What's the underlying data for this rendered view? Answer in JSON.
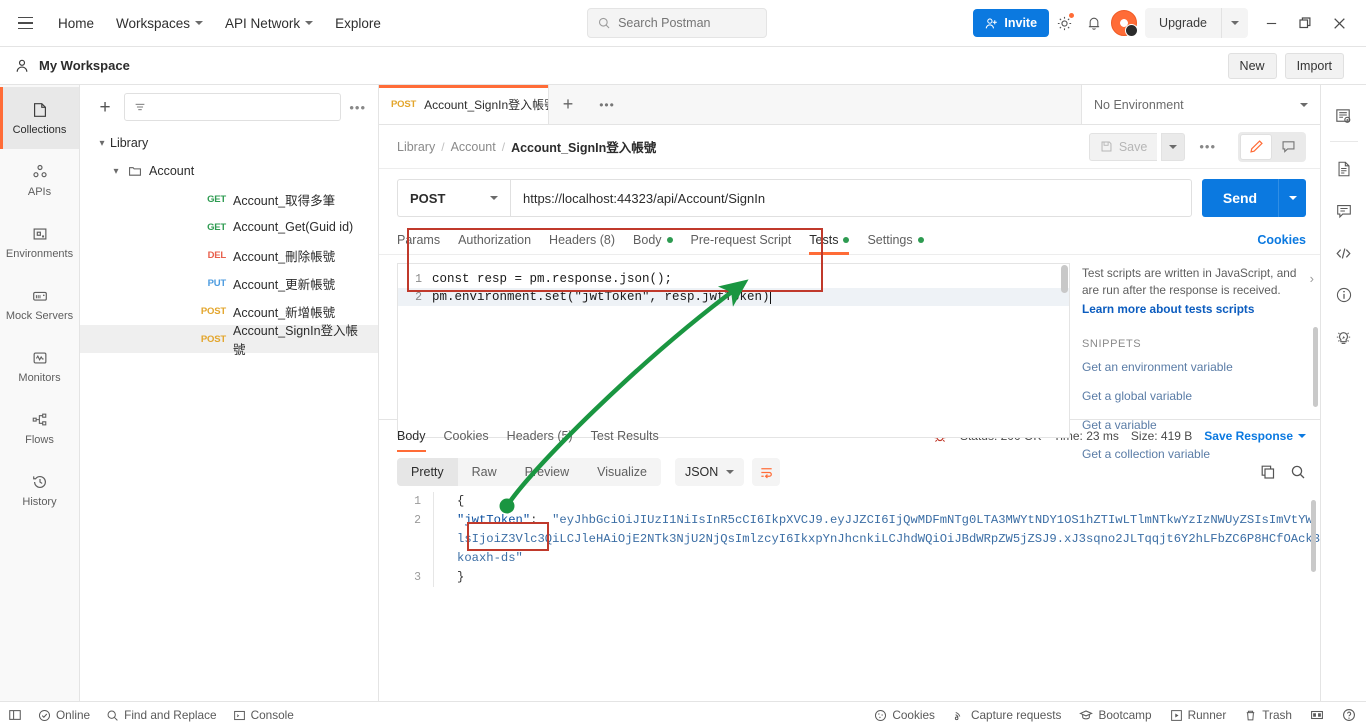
{
  "topbar": {
    "menu_icon": "hamburger-icon",
    "nav": [
      {
        "label": "Home",
        "has_caret": false
      },
      {
        "label": "Workspaces",
        "has_caret": true
      },
      {
        "label": "API Network",
        "has_caret": true
      },
      {
        "label": "Explore",
        "has_caret": false
      }
    ],
    "search_placeholder": "Search Postman",
    "invite_label": "Invite",
    "upgrade_label": "Upgrade",
    "settings_icon": "gear-icon",
    "notifications_icon": "bell-icon",
    "avatar_icon": "user-avatar",
    "minimize_icon": "minimize-icon",
    "maximize_icon": "maximize-icon",
    "close_icon": "close-icon"
  },
  "workspace_bar": {
    "name": "My Workspace",
    "new_label": "New",
    "import_label": "Import"
  },
  "rail": {
    "items": [
      {
        "label": "Collections",
        "icon": "collections-icon",
        "active": true
      },
      {
        "label": "APIs",
        "icon": "apis-icon",
        "active": false
      },
      {
        "label": "Environments",
        "icon": "environments-icon",
        "active": false
      },
      {
        "label": "Mock Servers",
        "icon": "mock-servers-icon",
        "active": false
      },
      {
        "label": "Monitors",
        "icon": "monitors-icon",
        "active": false
      },
      {
        "label": "Flows",
        "icon": "flows-icon",
        "active": false
      },
      {
        "label": "History",
        "icon": "history-icon",
        "active": false
      }
    ]
  },
  "sidebar": {
    "filter_placeholder": "",
    "tree": [
      {
        "label": "Library",
        "type": "collection",
        "depth": 0,
        "expanded": true
      },
      {
        "label": "Account",
        "type": "folder",
        "depth": 1,
        "expanded": true
      },
      {
        "label": "Account_取得多筆",
        "method": "GET",
        "depth": 2
      },
      {
        "label": "Account_Get(Guid id)",
        "method": "GET",
        "depth": 2
      },
      {
        "label": "Account_刪除帳號",
        "method": "DEL",
        "depth": 2
      },
      {
        "label": "Account_更新帳號",
        "method": "PUT",
        "depth": 2
      },
      {
        "label": "Account_新增帳號",
        "method": "POST",
        "depth": 2
      },
      {
        "label": "Account_SignIn登入帳號",
        "method": "POST",
        "depth": 2,
        "selected": true
      }
    ]
  },
  "tabstrip": {
    "tab": {
      "method": "POST",
      "title": "Account_SignIn登入帳號"
    },
    "environment": "No Environment"
  },
  "breadcrumb": {
    "parts": [
      "Library",
      "Account"
    ],
    "current": "Account_SignIn登入帳號",
    "save_label": "Save"
  },
  "request": {
    "method": "POST",
    "url": "https://localhost:44323/api/Account/SignIn",
    "send_label": "Send",
    "tabs": [
      {
        "label": "Params",
        "dot": false,
        "active": false
      },
      {
        "label": "Authorization",
        "dot": false,
        "active": false
      },
      {
        "label": "Headers (8)",
        "dot": false,
        "active": false
      },
      {
        "label": "Body",
        "dot": true,
        "active": false
      },
      {
        "label": "Pre-request Script",
        "dot": false,
        "active": false
      },
      {
        "label": "Tests",
        "dot": true,
        "active": true
      },
      {
        "label": "Settings",
        "dot": true,
        "active": false
      }
    ],
    "cookies_link": "Cookies"
  },
  "editor": {
    "lines": [
      {
        "num": "1",
        "text": "const resp = pm.response.json();"
      },
      {
        "num": "2",
        "text": "pm.environment.set(\"jwtToken\", resp.jwtToken)"
      }
    ]
  },
  "snippets": {
    "description": "Test scripts are written in JavaScript, and are run after the response is received.",
    "learn_more": "Learn more about tests scripts",
    "heading": "SNIPPETS",
    "items": [
      "Get an environment variable",
      "Get a global variable",
      "Get a variable",
      "Get a collection variable"
    ]
  },
  "response": {
    "tabs": [
      {
        "label": "Body",
        "active": true
      },
      {
        "label": "Cookies",
        "active": false
      },
      {
        "label": "Headers (5)",
        "active": false
      },
      {
        "label": "Test Results",
        "active": false
      }
    ],
    "status": "Status: 200 OK",
    "time": "Time: 23 ms",
    "size": "Size: 419 B",
    "save_response": "Save Response",
    "view_pills": [
      {
        "label": "Pretty",
        "active": true
      },
      {
        "label": "Raw",
        "active": false
      },
      {
        "label": "Preview",
        "active": false
      },
      {
        "label": "Visualize",
        "active": false
      }
    ],
    "format": "JSON",
    "copy_icon": "copy-icon",
    "search_icon": "search-icon",
    "json": {
      "line1": "{",
      "line2_key": "\"jwtToken\"",
      "line2_colon": ":",
      "line2_value": "\"eyJhbGciOiJIUzI1NiIsInR5cCI6IkpXVCJ9.eyJJZCI6IjQwMDFmNTg0LTA3MWYtNDY1OS1hZTIwLTlmNTkwYzIzNWUyZSIsImVtYWlsIjoiZ3Vlc3QiLCJleHAiOjE2NTk3NjU2NjQsImlzcyI6IkxpYnJhcnkiLCJhdWQiOiJBdWRpZW5jZSJ9.xJ3sqno2JLTqqjt6Y2hLFbZC6P8HCfOAck3koaxh-ds\"",
      "line3": "}"
    }
  },
  "right_rail": {
    "items": [
      {
        "icon": "environment-quicklook-icon"
      },
      {
        "icon": "documentation-icon"
      },
      {
        "icon": "comments-icon"
      },
      {
        "icon": "code-icon"
      },
      {
        "icon": "info-icon"
      },
      {
        "icon": "lightbulb-icon"
      }
    ]
  },
  "statusbar": {
    "left": [
      {
        "label": "",
        "icon": "sidebar-toggle-icon"
      },
      {
        "label": "Online",
        "icon": "online-icon"
      },
      {
        "label": "Find and Replace",
        "icon": "search-icon"
      },
      {
        "label": "Console",
        "icon": "console-icon"
      }
    ],
    "right": [
      {
        "label": "Cookies",
        "icon": "cookie-icon"
      },
      {
        "label": "Capture requests",
        "icon": "capture-icon"
      },
      {
        "label": "Bootcamp",
        "icon": "bootcamp-icon"
      },
      {
        "label": "Runner",
        "icon": "runner-icon"
      },
      {
        "label": "Trash",
        "icon": "trash-icon"
      },
      {
        "label": "",
        "icon": "layout-icon"
      },
      {
        "label": "",
        "icon": "help-icon"
      }
    ]
  },
  "annotations": {
    "highlight_color": "#c0392b",
    "arrow_color": "#1a9641"
  }
}
